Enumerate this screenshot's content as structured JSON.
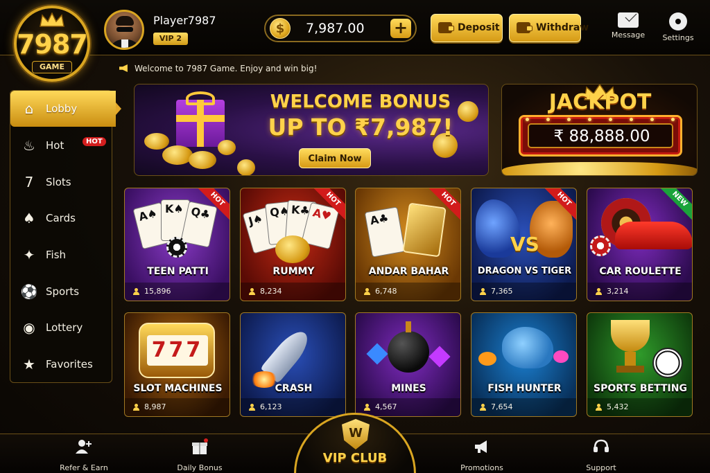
{
  "header": {
    "logo": {
      "number": "7987",
      "word": "GAME"
    },
    "player_name": "Player7987",
    "vip_level": "VIP 2",
    "balance": "7,987.00",
    "coin_symbol": "$",
    "add_symbol": "+",
    "deposit_label": "Deposit",
    "withdraw_label": "Withdraw",
    "message_label": "Message",
    "settings_label": "Settings"
  },
  "announcement": "Welcome to 7987 Game. Enjoy and win big!",
  "sidebar": {
    "items": [
      {
        "label": "Lobby",
        "icon": "home-icon",
        "glyph": "⌂",
        "active": true
      },
      {
        "label": "Hot",
        "icon": "flame-icon",
        "glyph": "♨",
        "badge": "HOT"
      },
      {
        "label": "Slots",
        "icon": "slot-machine-icon",
        "glyph": "7"
      },
      {
        "label": "Cards",
        "icon": "cards-icon",
        "glyph": "♠"
      },
      {
        "label": "Fish",
        "icon": "fish-icon",
        "glyph": "✦"
      },
      {
        "label": "Sports",
        "icon": "soccer-ball-icon",
        "glyph": "⚽"
      },
      {
        "label": "Lottery",
        "icon": "lottery-ball-icon",
        "glyph": "◉"
      },
      {
        "label": "Favorites",
        "icon": "star-icon",
        "glyph": "★"
      }
    ]
  },
  "welcome_banner": {
    "title": "WELCOME BONUS",
    "amount": "UP TO ₹7,987!",
    "button_label": "Claim Now"
  },
  "jackpot": {
    "title": "JACKPOT",
    "amount": "₹ 88,888.00"
  },
  "games": [
    {
      "title": "TEEN PATTI",
      "players": "15,896",
      "tag": "HOT",
      "theme": "purple"
    },
    {
      "title": "RUMMY",
      "players": "8,234",
      "tag": "HOT",
      "theme": "red"
    },
    {
      "title": "ANDAR BAHAR",
      "players": "6,748",
      "tag": "HOT",
      "theme": "orange"
    },
    {
      "title": "DRAGON VS TIGER",
      "players": "7,365",
      "tag": "HOT",
      "theme": "blue",
      "vs": "VS"
    },
    {
      "title": "CAR ROULETTE",
      "players": "3,214",
      "tag": "NEW",
      "theme": "violet"
    },
    {
      "title": "SLOT MACHINES",
      "players": "8,987",
      "theme": "gold",
      "reels": "777"
    },
    {
      "title": "CRASH",
      "players": "6,123",
      "theme": "blue"
    },
    {
      "title": "MINES",
      "players": "4,567",
      "theme": "violet"
    },
    {
      "title": "FISH HUNTER",
      "players": "7,654",
      "theme": "teal"
    },
    {
      "title": "SPORTS BETTING",
      "players": "5,432",
      "theme": "green"
    }
  ],
  "bottom_nav": {
    "refer_label": "Refer & Earn",
    "daily_bonus_label": "Daily Bonus",
    "vip_club_label": "VIP CLUB",
    "vip_emblem": "W",
    "promotions_label": "Promotions",
    "support_label": "Support"
  },
  "colors": {
    "gold": "#ffd24a",
    "hot_red": "#d21b1b",
    "new_green": "#1aa33a",
    "background": "#0b0804"
  }
}
